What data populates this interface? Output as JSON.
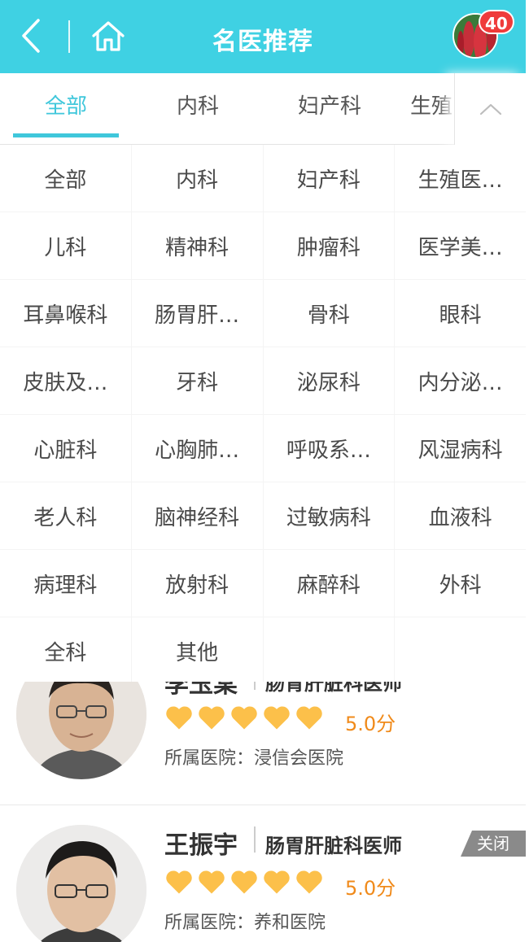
{
  "header": {
    "title": "名医推荐",
    "badge_count": "40",
    "accent_color": "#3fd1e3"
  },
  "tabs": [
    {
      "label": "全部",
      "active": true
    },
    {
      "label": "内科"
    },
    {
      "label": "妇产科"
    },
    {
      "label": "生殖"
    }
  ],
  "categories": [
    "全部",
    "内科",
    "妇产科",
    "生殖医…",
    "儿科",
    "精神科",
    "肿瘤科",
    "医学美…",
    "耳鼻喉科",
    "肠胃肝…",
    "骨科",
    "眼科",
    "皮肤及…",
    "牙科",
    "泌尿科",
    "内分泌…",
    "心脏科",
    "心胸肺…",
    "呼吸系…",
    "风湿病科",
    "老人科",
    "脑神经科",
    "过敏病科",
    "血液科",
    "病理科",
    "放射科",
    "麻醉科",
    "外科",
    "全科",
    "其他"
  ],
  "doctors": [
    {
      "name": "李玉棠",
      "dept": "肠胃肝脏科医师",
      "rating": "5.0分",
      "stars": 5,
      "hospital_label": "所属医院：",
      "hospital": "浸信会医院"
    },
    {
      "name": "王振宇",
      "dept": "肠胃肝脏科医师",
      "rating": "5.0分",
      "stars": 5,
      "hospital_label": "所属医院：",
      "hospital": "养和医院"
    }
  ],
  "close_label": "关闭",
  "icons": {
    "back": "chevron-left-icon",
    "home": "home-icon",
    "collapse": "chevron-up-icon",
    "heart": "heart-icon"
  },
  "colors": {
    "active_tab": "#3fc7db",
    "heart": "#fcc04a",
    "rating": "#f08a1a",
    "badge": "#ef3b3b"
  }
}
